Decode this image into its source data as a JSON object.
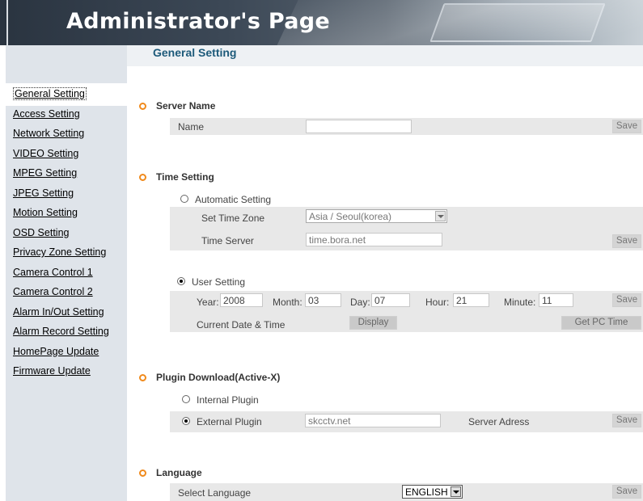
{
  "header": {
    "title": "Administrator's Page"
  },
  "page_title": "General Setting",
  "sidebar": {
    "items": [
      {
        "label": "General Setting"
      },
      {
        "label": "Access Setting"
      },
      {
        "label": "Network Setting"
      },
      {
        "label": "VIDEO Setting"
      },
      {
        "label": "MPEG Setting"
      },
      {
        "label": "JPEG Setting"
      },
      {
        "label": "Motion Setting"
      },
      {
        "label": "OSD Setting"
      },
      {
        "label": "Privacy Zone Setting"
      },
      {
        "label": "Camera Control 1"
      },
      {
        "label": "Camera Control 2"
      },
      {
        "label": "Alarm In/Out Setting"
      },
      {
        "label": "Alarm Record Setting"
      },
      {
        "label": "HomePage Update"
      },
      {
        "label": "Firmware Update"
      }
    ]
  },
  "server_name": {
    "title": "Server Name",
    "name_label": "Name",
    "name_value": "",
    "save": "Save"
  },
  "time_setting": {
    "title": "Time Setting",
    "auto_label": "Automatic Setting",
    "timezone_label": "Set Time Zone",
    "timezone_value": "Asia / Seoul(korea)",
    "timeserver_label": "Time Server",
    "timeserver_value": "time.bora.net",
    "save": "Save",
    "user_label": "User Setting",
    "year_label": "Year:",
    "year_value": "2008",
    "month_label": "Month:",
    "month_value": "03",
    "day_label": "Day:",
    "day_value": "07",
    "hour_label": "Hour:",
    "hour_value": "21",
    "minute_label": "Minute:",
    "minute_value": "11",
    "save2": "Save",
    "current_label": "Current Date & Time",
    "display_btn": "Display",
    "getpc_btn": "Get PC Time"
  },
  "plugin": {
    "title": "Plugin Download(Active-X)",
    "internal_label": "Internal Plugin",
    "external_label": "External Plugin",
    "server_value": "skcctv.net",
    "server_label": "Server Adress",
    "save": "Save"
  },
  "language": {
    "title": "Language",
    "select_label": "Select Language",
    "selected": "ENGLISH",
    "save": "Save"
  }
}
